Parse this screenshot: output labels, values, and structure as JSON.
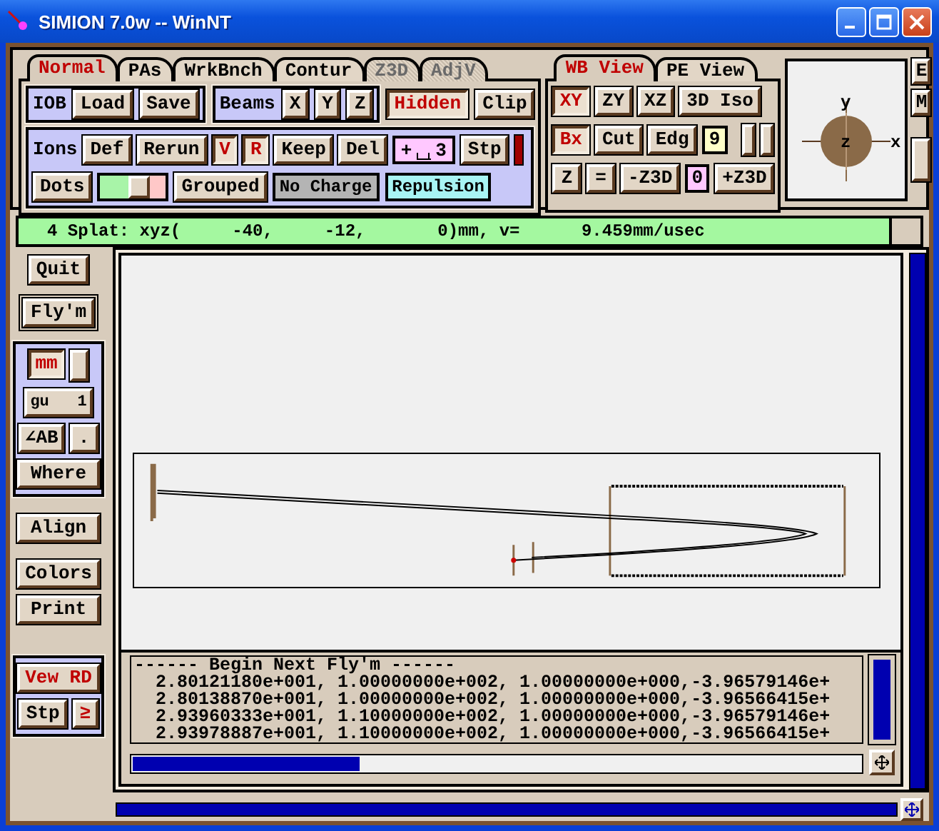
{
  "window": {
    "title": "SIMION 7.0w -- WinNT"
  },
  "main_tabs": [
    {
      "label": "Normal",
      "selected": true,
      "disabled": false
    },
    {
      "label": "PAs",
      "selected": false,
      "disabled": false
    },
    {
      "label": "WrkBnch",
      "selected": false,
      "disabled": false
    },
    {
      "label": "Contur",
      "selected": false,
      "disabled": false
    },
    {
      "label": "Z3D",
      "selected": false,
      "disabled": true
    },
    {
      "label": "AdjV",
      "selected": false,
      "disabled": true
    }
  ],
  "iob": {
    "label": "IOB",
    "buttons": [
      {
        "label": "Load",
        "on": false
      },
      {
        "label": "Save",
        "on": false
      }
    ]
  },
  "beams": {
    "label": "Beams",
    "buttons": [
      {
        "label": "X",
        "on": false
      },
      {
        "label": "Y",
        "on": false
      },
      {
        "label": "Z",
        "on": false
      }
    ]
  },
  "view_toggles": [
    {
      "label": "Hidden",
      "on": true
    },
    {
      "label": "Clip",
      "on": false
    }
  ],
  "ions": {
    "label": "Ions",
    "buttons": [
      {
        "label": "Def",
        "on": false
      },
      {
        "label": "Rerun",
        "on": false
      },
      {
        "label": "V",
        "on": true
      },
      {
        "label": "R",
        "on": true
      },
      {
        "label": "Keep",
        "on": false
      },
      {
        "label": "Del",
        "on": false
      }
    ],
    "step_field": {
      "sign": "+",
      "value": "3"
    },
    "step_button": {
      "label": "Stp",
      "on": false
    },
    "dots_button": {
      "label": "Dots",
      "on": false
    },
    "dots_slider": {
      "level": 0.6
    },
    "grouped_button": {
      "label": "Grouped",
      "on": false
    },
    "charge_options": [
      {
        "label": "No Charge",
        "color": "#b4b4b4"
      },
      {
        "label": "Repulsion",
        "color": "#a8f4f4"
      }
    ]
  },
  "view_tabs": [
    {
      "label": "WB View",
      "selected": true
    },
    {
      "label": "PE View",
      "selected": false
    }
  ],
  "view_rows": [
    [
      {
        "kind": "button",
        "label": "XY",
        "on": true
      },
      {
        "kind": "button",
        "label": "ZY",
        "on": false
      },
      {
        "kind": "button",
        "label": "XZ",
        "on": false
      },
      {
        "kind": "button",
        "label": "3D Iso",
        "on": false
      }
    ],
    [
      {
        "kind": "button",
        "label": "Bx",
        "on": true
      },
      {
        "kind": "button",
        "label": "Cut",
        "on": false
      },
      {
        "kind": "button",
        "label": "Edg",
        "on": false
      },
      {
        "kind": "field",
        "value": "9",
        "color": "#ffffc8"
      },
      {
        "kind": "spin"
      }
    ],
    [
      {
        "kind": "button",
        "label": "Z",
        "on": false
      },
      {
        "kind": "button",
        "label": "=",
        "on": false
      },
      {
        "kind": "button",
        "label": "-Z3D",
        "on": false
      },
      {
        "kind": "field",
        "value": "0",
        "color": "#ffc8ff"
      },
      {
        "kind": "button",
        "label": "+Z3D",
        "on": false
      }
    ]
  ],
  "compass": {
    "axes": [
      "y",
      "z",
      "x"
    ]
  },
  "side_buttons": [
    "E",
    "M"
  ],
  "status": "4 Splat: xyz(     -40,     -12,       0)mm, v=      9.459mm/usec",
  "sidebar": {
    "top": [
      {
        "label": "Quit",
        "on": false
      },
      {
        "label": "Fly'm",
        "on": false
      }
    ],
    "units": {
      "unit_button": {
        "label": "mm",
        "on": true
      },
      "grid_button": {
        "label": "gu   1",
        "on": false
      },
      "angle_button": {
        "label": "∠AB",
        "on": false
      },
      "dot_button": {
        "label": ".",
        "on": false
      },
      "where_button": {
        "label": "Where",
        "on": false
      }
    },
    "middle": [
      {
        "label": "Align",
        "on": false
      },
      {
        "label": "Colors",
        "on": false
      },
      {
        "label": "Print",
        "on": false
      }
    ],
    "record": {
      "view_button": {
        "label": "Vew RD",
        "on": false
      },
      "step_button": {
        "label": "Stp",
        "on": false
      },
      "next_button": {
        "label": "≥",
        "on": false
      }
    }
  },
  "output": {
    "lines": [
      "------ Begin Next Fly'm ------",
      "  2.80121180e+001, 1.00000000e+002, 1.00000000e+000,-3.96579146e+",
      "  2.80138870e+001, 1.00000000e+002, 1.00000000e+000,-3.96566415e+",
      "  2.93960333e+001, 1.10000000e+002, 1.00000000e+000,-3.96579146e+",
      "  2.93978887e+001, 1.10000000e+002, 1.00000000e+000,-3.96566415e+"
    ]
  }
}
